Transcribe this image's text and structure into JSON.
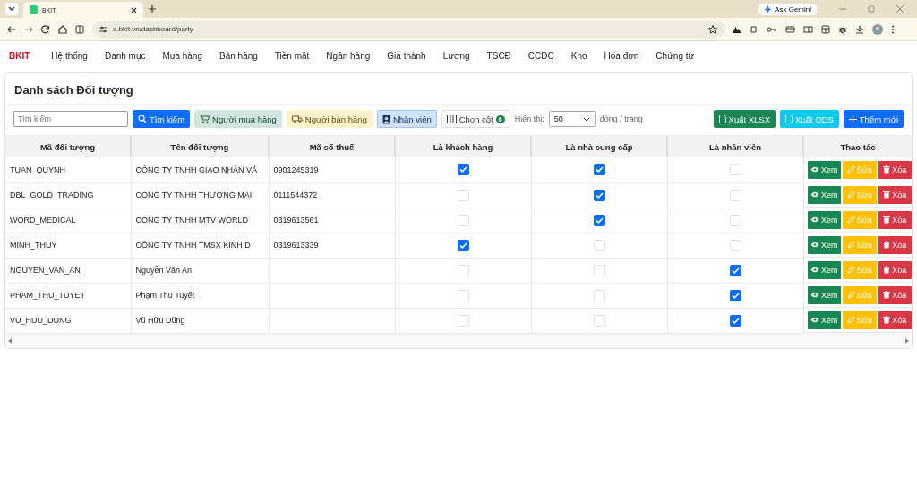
{
  "browser": {
    "tab_title": "BKIT",
    "url": "a.bkit.vn/dashboard/party",
    "ask_button": "Ask Gemini"
  },
  "nav": {
    "brand": "BKIT",
    "items": [
      "Hệ thống",
      "Danh mục",
      "Mua hàng",
      "Bán hàng",
      "Tiền mặt",
      "Ngân hàng",
      "Giá thành",
      "Lương",
      "TSCĐ",
      "CCDC",
      "Kho",
      "Hóa đơn",
      "Chứng từ"
    ]
  },
  "title": "Danh sách Đối tượng",
  "toolbar": {
    "search": {
      "placeholder": "Tìm kiếm"
    },
    "search_button": "Tìm kiếm",
    "filters": [
      {
        "kind": "buyer",
        "label": "Người mua hàng"
      },
      {
        "kind": "seller",
        "label": "Người bán hàng"
      },
      {
        "kind": "employee",
        "label": "Nhân viên"
      }
    ],
    "columns_button": "Chọn cột",
    "columns_count": "6",
    "show_label": "Hiển thị:",
    "page_size": "50",
    "per_page": "dòng / trang",
    "export": [
      {
        "kind": "xlsx",
        "label": "Xuất XLSX"
      },
      {
        "kind": "ods",
        "label": "Xuất ODS"
      },
      {
        "kind": "add",
        "label": "Thêm mới"
      }
    ]
  },
  "table": {
    "columns": [
      "Mã đối tượng",
      "Tên đối tượng",
      "Mã số thuế",
      "Là khách hàng",
      "Là nhà cung cấp",
      "Là nhân viên",
      "Thao tác"
    ],
    "rows": [
      {
        "code": "TUAN_QUYNH",
        "name": "CÔNG TY TNHH GIAO NHẬN VẢ",
        "tax": "0901245319",
        "customer": true,
        "supplier": true,
        "employee": false,
        "actions": [
          {
            "kind": "view",
            "label": "Xem"
          },
          {
            "kind": "edit",
            "label": "Sửa"
          },
          {
            "kind": "delete",
            "label": "Xóa"
          }
        ]
      },
      {
        "code": "DBL_GOLD_TRADING",
        "name": "CÔNG TY TNHH THƯƠNG MẠI",
        "tax": "0111544372",
        "customer": false,
        "supplier": true,
        "employee": false,
        "actions": [
          {
            "kind": "view",
            "label": "Xem"
          },
          {
            "kind": "edit",
            "label": "Sửa"
          },
          {
            "kind": "delete",
            "label": "Xóa"
          }
        ]
      },
      {
        "code": "WORD_MEDICAL",
        "name": "CÔNG TY TNHH MTV WORLD",
        "tax": "0319613561",
        "customer": false,
        "supplier": true,
        "employee": false,
        "actions": [
          {
            "kind": "view",
            "label": "Xem"
          },
          {
            "kind": "edit",
            "label": "Sửa"
          },
          {
            "kind": "delete",
            "label": "Xóa"
          }
        ]
      },
      {
        "code": "MINH_THUY",
        "name": "CÔNG TY TNHH TMSX KINH D",
        "tax": "0319613339",
        "customer": true,
        "supplier": false,
        "employee": false,
        "actions": [
          {
            "kind": "view",
            "label": "Xem"
          },
          {
            "kind": "edit",
            "label": "Sửa"
          },
          {
            "kind": "delete",
            "label": "Xóa"
          }
        ]
      },
      {
        "code": "NGUYEN_VAN_AN",
        "name": "Nguyễn Văn An",
        "customer": false,
        "supplier": false,
        "employee": true,
        "actions": [
          {
            "kind": "view",
            "label": "Xem"
          },
          {
            "kind": "edit",
            "label": "Sửa"
          },
          {
            "kind": "delete",
            "label": "Xóa"
          }
        ]
      },
      {
        "code": "PHAM_THU_TUYET",
        "name": "Phạm Thu Tuyết",
        "customer": false,
        "supplier": false,
        "employee": true,
        "actions": [
          {
            "kind": "view",
            "label": "Xem"
          },
          {
            "kind": "edit",
            "label": "Sửa"
          },
          {
            "kind": "delete",
            "label": "Xóa"
          }
        ]
      },
      {
        "code": "VU_HUU_DUNG",
        "name": "Vũ Hữu Dũng",
        "customer": false,
        "supplier": false,
        "employee": true,
        "actions": [
          {
            "kind": "view",
            "label": "Xem"
          },
          {
            "kind": "edit",
            "label": "Sửa"
          },
          {
            "kind": "delete",
            "label": "Xóa"
          }
        ]
      }
    ]
  }
}
